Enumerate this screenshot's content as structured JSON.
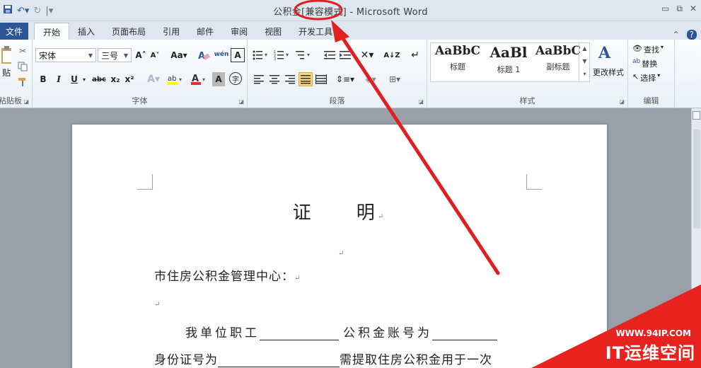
{
  "window": {
    "title_prefix": "公积金",
    "title_mode": "[兼容模式]",
    "title_suffix": " - Microsoft Word"
  },
  "qat": {
    "save_icon": "save-icon",
    "undo": "↶▾",
    "redo": "↻",
    "customize": "|▾"
  },
  "window_controls": {
    "minimize": "▭",
    "restore": "⧉",
    "close": "✕"
  },
  "tabs": {
    "file": "文件",
    "home": "开始",
    "insert": "插入",
    "page_layout": "页面布局",
    "references": "引用",
    "mailings": "邮件",
    "review": "审阅",
    "view": "视图",
    "developer": "开发工具",
    "help_toggle": "⌃",
    "help": "?"
  },
  "ribbon": {
    "clipboard": {
      "paste": "贴",
      "label": "粘贴板"
    },
    "font": {
      "font_name": "宋体",
      "font_size": "三号",
      "grow": "A˄",
      "shrink": "A˅",
      "change_case": "Aa▾",
      "clear_format": "A",
      "phonetic": "wén",
      "bold": "B",
      "italic": "I",
      "underline": "U",
      "strike": "abc",
      "subscript": "x₂",
      "superscript": "x²",
      "label": "字体"
    },
    "paragraph": {
      "label": "段落"
    },
    "styles": {
      "items": [
        {
          "sample": "AaBbC",
          "name": "标题"
        },
        {
          "sample": "AaBl",
          "name": "标题 1"
        },
        {
          "sample": "AaBbC",
          "name": "副标题"
        }
      ],
      "change_styles": "更改样式",
      "label": "样式"
    },
    "editing": {
      "find": "查找",
      "replace": "替换",
      "select": "选择",
      "label": "编辑"
    }
  },
  "document": {
    "title": "证　　明",
    "addressee": "市住房公积金管理中心：",
    "line1_a": "我单位职工",
    "line1_b": "公积金账号为",
    "line2_a": "身份证号为",
    "line2_b": "需提取住房公积金用于一次",
    "para_mark": "↵"
  },
  "watermark": {
    "url": "WWW.94IP.COM",
    "name": "IT运维空间"
  },
  "colors": {
    "arrow": "#e02020",
    "file_tab": "#2b5797",
    "watermark": "#e8231f"
  }
}
